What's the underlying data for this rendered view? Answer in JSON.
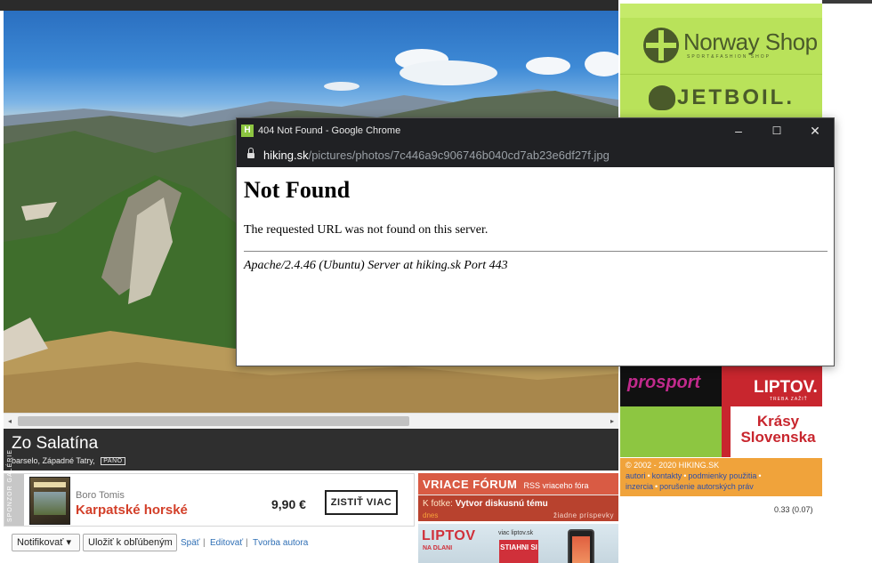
{
  "browser_popup": {
    "window_title": "404 Not Found - Google Chrome",
    "favicon_letter": "H",
    "url_host": "hiking.sk",
    "url_path": "/pictures/photos/7c446a9c906746b040cd7ab23e6df27f.jpg",
    "controls": {
      "minimize": "–",
      "maximize": "☐",
      "close": "✕"
    },
    "heading": "Not Found",
    "message": "The requested URL was not found on this server.",
    "server_address": "Apache/2.4.46 (Ubuntu) Server at hiking.sk Port 443"
  },
  "photo": {
    "title": "Zo Salatína",
    "meta": "barselo, Západné Tatry,",
    "badge": "PANO"
  },
  "scrollbar": {
    "left_arrow": "◂",
    "right_arrow": "▸"
  },
  "sponsor_gallery": {
    "tab_label": "SPONZOR GALÉRIE",
    "author": "Boro Tomis",
    "title": "Karpatské horské",
    "price": "9,90 €",
    "cta": "ZISTIŤ VIAC"
  },
  "actions": {
    "notify": "Notifikovať ▾",
    "favorite": "Uložiť k obľúbeným",
    "back": "Späť",
    "edit": "Editovať",
    "author_work": "Tvorba autora",
    "separator": "|"
  },
  "forum": {
    "heading": "VRIACE FÓRUM",
    "rss": "RSS vriaceho fóra",
    "prefix": "K fotke:",
    "topic": "Vytvor diskusnú tému",
    "today": "dnes",
    "none": "žiadne príspevky"
  },
  "liptov_banner": {
    "title": "LIPTOV",
    "subtitle": "NA DLANI",
    "link": "viac liptov.sk",
    "badge": "STIAHNI SI"
  },
  "sidebar": {
    "norway_shop": {
      "name": "Norway Shop",
      "tagline": "SPORT&FASHION SHOP"
    },
    "jetboil": "JETBOIL.",
    "prosport": "prosport",
    "liptov": {
      "name": "LIPTOV.",
      "tagline": "TREBA ZAŽIŤ"
    },
    "krasy": "Krásy Slovenska",
    "copyright": "© 2002 - 2020 HIKING.SK",
    "footer_links": [
      "autori",
      "kontakty",
      "podmienky použitia",
      "inzercia",
      "porušenie autorských práv"
    ],
    "footer_dot": "•",
    "timing": "0.33 (0.07)"
  },
  "colors": {
    "accent_red": "#d3402a",
    "link_blue": "#2f6fb5",
    "lime": "#b9e25a",
    "chrome_dark": "#202124"
  }
}
